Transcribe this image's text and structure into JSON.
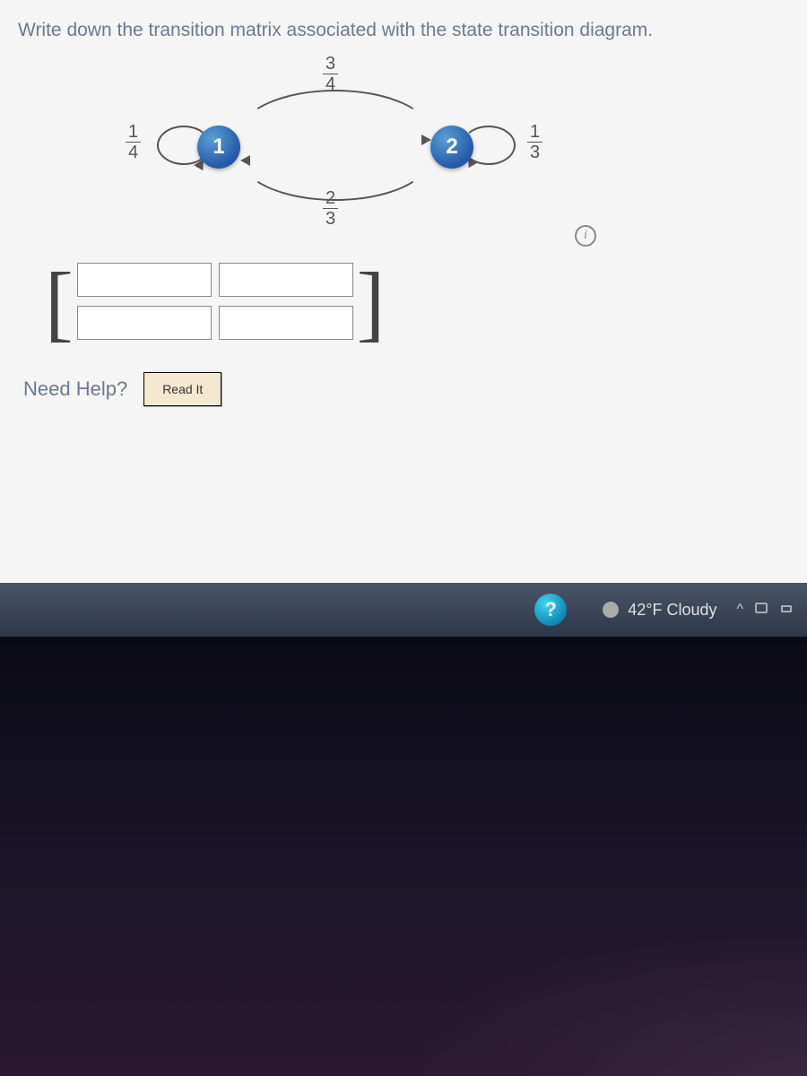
{
  "question": {
    "prompt": "Write down the transition matrix associated with the state transition diagram."
  },
  "diagram": {
    "state1_label": "1",
    "state2_label": "2",
    "self_loop_1": {
      "num": "1",
      "den": "4"
    },
    "transition_1_2": {
      "num": "3",
      "den": "4"
    },
    "transition_2_1": {
      "num": "2",
      "den": "3"
    },
    "self_loop_2": {
      "num": "1",
      "den": "3"
    },
    "info_icon": "i"
  },
  "matrix": {
    "left_bracket": "[",
    "right_bracket": "]",
    "cells": [
      "",
      "",
      "",
      ""
    ]
  },
  "help": {
    "label": "Need Help?",
    "read_it": "Read It"
  },
  "taskbar": {
    "help_icon": "?",
    "weather": "42°F Cloudy",
    "tray_chevron": "^"
  }
}
